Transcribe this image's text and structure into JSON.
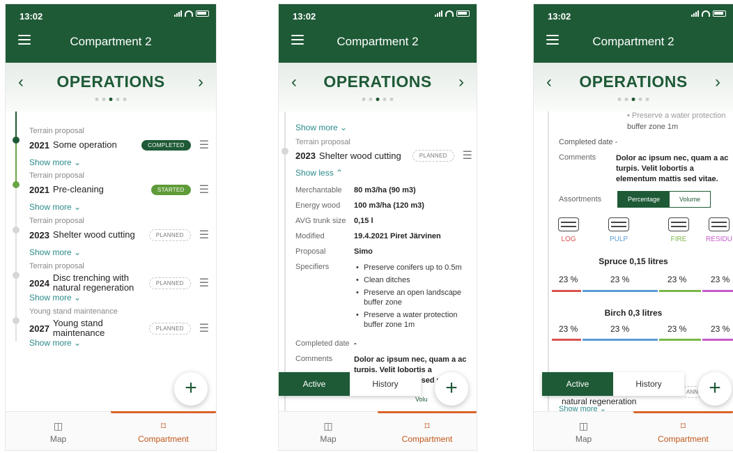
{
  "status": {
    "time": "13:02"
  },
  "header": {
    "title": "Compartment 2"
  },
  "operations": {
    "title": "OPERATIONS",
    "prev": "‹",
    "next": "›"
  },
  "colors": {
    "primary": "#1e5a36",
    "started": "#5f9b38",
    "accent": "#d9642a",
    "link": "#2b8a8a"
  },
  "screen1": {
    "items": [
      {
        "category": "Terrain proposal",
        "year": "2021",
        "name": "Some operation",
        "status": "COMPLETED",
        "more": "Show more"
      },
      {
        "category": "Terrain proposal",
        "year": "2021",
        "name": "Pre-cleaning",
        "status": "STARTED",
        "more": "Show more"
      },
      {
        "category": "Terrain proposal",
        "year": "2023",
        "name": "Shelter wood cutting",
        "status": "PLANNED",
        "more": "Show more"
      },
      {
        "category": "Terrain proposal",
        "year": "2024",
        "name": "Disc trenching with natural regeneration",
        "status": "PLANNED",
        "more": "Show more"
      },
      {
        "category": "Young stand maintenance",
        "year": "2027",
        "name": "Young stand maintenance",
        "status": "PLANNED",
        "more": "Show more"
      }
    ]
  },
  "screen2": {
    "top_more": "Show more",
    "item": {
      "category": "Terrain proposal",
      "year": "2023",
      "name": "Shelter wood cutting",
      "status": "PLANNED",
      "less": "Show less"
    },
    "fields": [
      {
        "k": "Merchantable",
        "v": "80 m3/ha (90 m3)"
      },
      {
        "k": "Energy wood",
        "v": "100 m3/ha (120 m3)"
      },
      {
        "k": "AVG trunk size",
        "v": "0,15 l"
      },
      {
        "k": "Modified",
        "v": "19.4.2021 Piret Järvinen"
      },
      {
        "k": "Proposal",
        "v": "Simo"
      }
    ],
    "specifiers_label": "Specifiers",
    "specifiers": [
      "Preserve conifers up to 0.5m",
      "Clean ditches",
      "Preserve an open landscape buffer zone",
      "Preserve a water protection buffer zone 1m"
    ],
    "completed_label": "Completed date",
    "completed_value": "-",
    "comments_label": "Comments",
    "comments": "Dolor ac ipsum nec, quam a ac turpis. Velit lobortis a elementum mattis sed vitae.",
    "peek": "Volu"
  },
  "screen3": {
    "cut_specifier": "Preserve a water protection",
    "cut_specifier_tail": "buffer zone 1m",
    "completed_label": "Completed date",
    "completed_value": "-",
    "comments_label": "Comments",
    "comments": "Dolor ac ipsum nec, quam a ac turpis. Velit lobortis a elementum mattis sed vitae.",
    "assortments_label": "Assortments",
    "toggle": {
      "on": "Percentage",
      "off": "Volume"
    },
    "assortments": [
      {
        "label": "LOG",
        "color": "#d9534f"
      },
      {
        "label": "PULP",
        "color": "#5b9bd5"
      },
      {
        "label": "FIRE",
        "color": "#7ab648"
      },
      {
        "label": "RESIDU",
        "color": "#c45ac9"
      }
    ],
    "species": [
      {
        "name": "Spruce  0,15 litres",
        "values": [
          "23 %",
          "23 %",
          "23 %",
          "23 %"
        ]
      },
      {
        "name": "Birch  0,3 litres",
        "values": [
          "23 %",
          "23 %",
          "23 %",
          "23 %"
        ]
      }
    ],
    "behind_text": "natural regeneration",
    "behind_more": "Show more",
    "behind_badge": "ANN"
  },
  "tabs": {
    "active": "Active",
    "history": "History"
  },
  "fab": "+",
  "nav": {
    "map": "Map",
    "compartment": "Compartment"
  }
}
